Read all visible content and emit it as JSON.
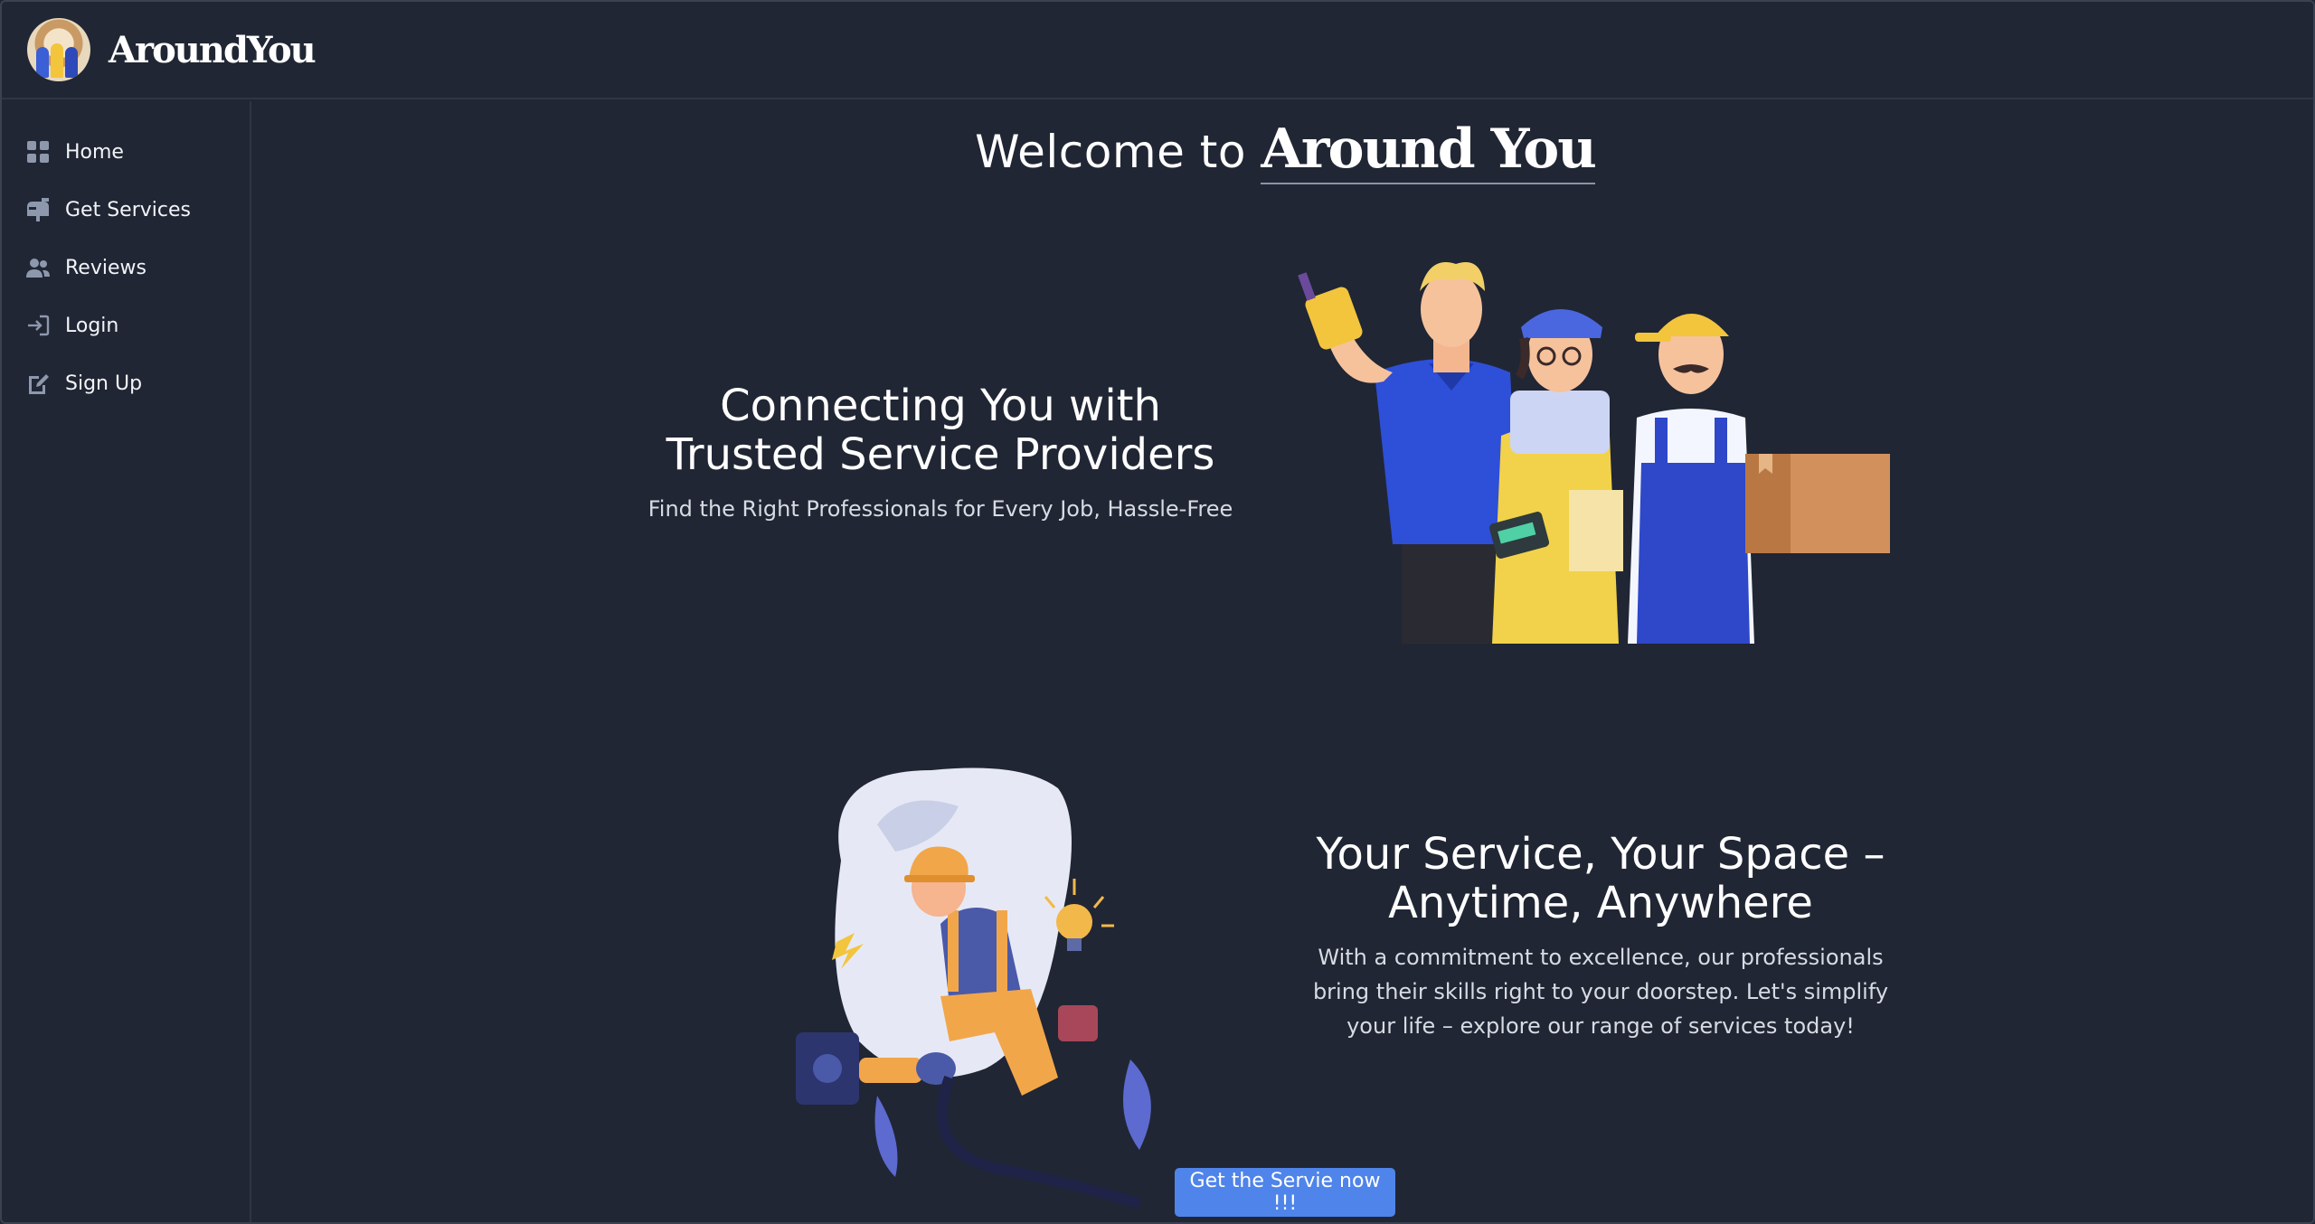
{
  "app": {
    "brand": "AroundYou"
  },
  "sidebar": {
    "items": [
      {
        "label": "Home",
        "icon": "grid-icon"
      },
      {
        "label": "Get Services",
        "icon": "mailbox-icon"
      },
      {
        "label": "Reviews",
        "icon": "users-icon"
      },
      {
        "label": "Login",
        "icon": "login-icon"
      },
      {
        "label": "Sign Up",
        "icon": "signup-icon"
      }
    ]
  },
  "main": {
    "welcome_prefix": "Welcome to",
    "welcome_brand": "Around You",
    "section1": {
      "title_line1": "Connecting You with",
      "title_line2": "Trusted Service Providers",
      "subtitle": "Find the Right Professionals for Every Job, Hassle-Free"
    },
    "section2": {
      "title_line1": "Your Service, Your Space –",
      "title_line2": "Anytime, Anywhere",
      "body_line1": "With a commitment to excellence, our professionals",
      "body_line2": "bring their skills right to your doorstep. Let's simplify",
      "body_line3": "your life – explore our range of services today!"
    },
    "cta_label": "Get the Servie now !!!"
  },
  "colors": {
    "background": "#202634",
    "accent": "#4f84ea",
    "divider": "#2e3646"
  }
}
